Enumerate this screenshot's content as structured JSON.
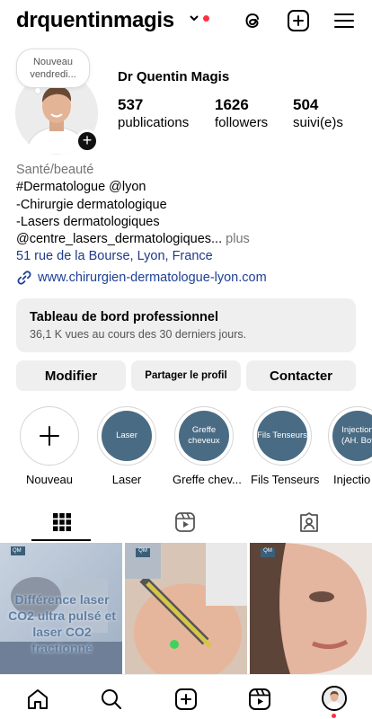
{
  "header": {
    "username": "drquentinmagis"
  },
  "profile": {
    "note": "Nouveau vendredi...",
    "full_name": "Dr Quentin Magis",
    "stats": [
      {
        "num": "537",
        "label": "publications"
      },
      {
        "num": "1626",
        "label": "followers"
      },
      {
        "num": "504",
        "label": "suivi(e)s"
      }
    ]
  },
  "bio": {
    "category": "Santé/beauté",
    "line1": "#Dermatologue @lyon",
    "line2": "-Chirurgie dermatologique",
    "line3": "-Lasers dermatologiques",
    "line4": "@centre_lasers_dermatologiques...",
    "more": " plus",
    "address": "51 rue de la Bourse, Lyon, France",
    "link": "www.chirurgien-dermatologue-lyon.com"
  },
  "dashboard": {
    "title": "Tableau de bord professionnel",
    "subtitle": "36,1 K vues au cours des 30 derniers jours."
  },
  "buttons": {
    "edit": "Modifier",
    "share": "Partager le profil",
    "contact": "Contacter"
  },
  "highlights": [
    {
      "caption": "Nouveau",
      "inner": ""
    },
    {
      "caption": "Laser",
      "inner": "Laser"
    },
    {
      "caption": "Greffe chev...",
      "inner": "Greffe cheveux"
    },
    {
      "caption": "Fils Tenseurs",
      "inner": "Fils Tenseurs"
    },
    {
      "caption": "Injectio",
      "inner": "Injection (AH. Bot"
    }
  ],
  "posts": [
    {
      "text": "Différence laser CO2 ultra pulsé et laser CO2 fractionné",
      "badge": "QM"
    },
    {
      "badge": "QM"
    },
    {
      "badge": "QM"
    }
  ],
  "colors": {
    "accent_link": "#1d3f94",
    "notification": "#ff3040",
    "highlight_bg": "#4a6b84"
  }
}
